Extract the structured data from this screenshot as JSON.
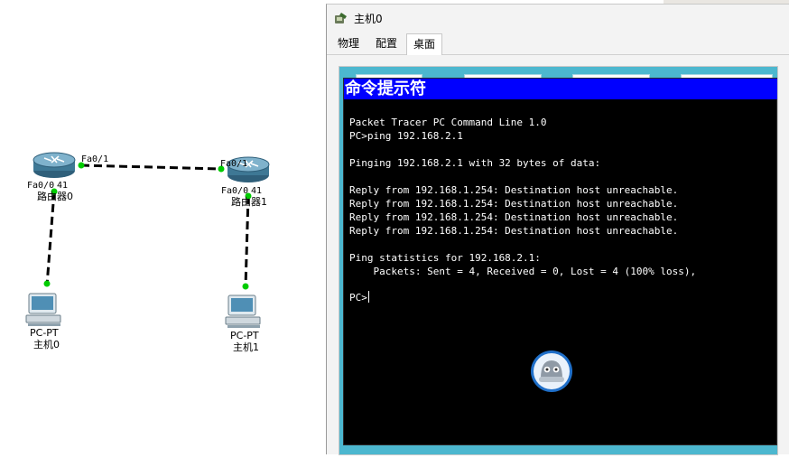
{
  "topology": {
    "routers": [
      {
        "name": "路由器0",
        "port_top": "Fa0/1",
        "port_bottom": "Fa0/0",
        "port_extra": "41"
      },
      {
        "name": "路由器1",
        "port_top": "Fa0/1",
        "port_bottom": "Fa0/0",
        "port_extra": "41"
      }
    ],
    "pcs": [
      {
        "model": "PC-PT",
        "name": "主机0"
      },
      {
        "model": "PC-PT",
        "name": "主机1"
      }
    ],
    "link_color": "#000000",
    "link_endpoint_color": "#00cc00"
  },
  "window": {
    "title": "主机0",
    "tabs": [
      {
        "label": "物理",
        "active": false
      },
      {
        "label": "配置",
        "active": false
      },
      {
        "label": "桌面",
        "active": true
      }
    ]
  },
  "cmd": {
    "title": "命令提示符",
    "lines": [
      "Packet Tracer PC Command Line 1.0",
      "PC>ping 192.168.2.1",
      "",
      "Pinging 192.168.2.1 with 32 bytes of data:",
      "",
      "Reply from 192.168.1.254: Destination host unreachable.",
      "Reply from 192.168.1.254: Destination host unreachable.",
      "Reply from 192.168.1.254: Destination host unreachable.",
      "Reply from 192.168.1.254: Destination host unreachable.",
      "",
      "Ping statistics for 192.168.2.1:",
      "    Packets: Sent = 4, Received = 0, Lost = 4 (100% loss),"
    ],
    "prompt": "PC>",
    "title_bg": "#0000ff",
    "bg": "#000000",
    "fg": "#ffffff"
  },
  "colors": {
    "desktop_bg": "#4cb7cf"
  }
}
